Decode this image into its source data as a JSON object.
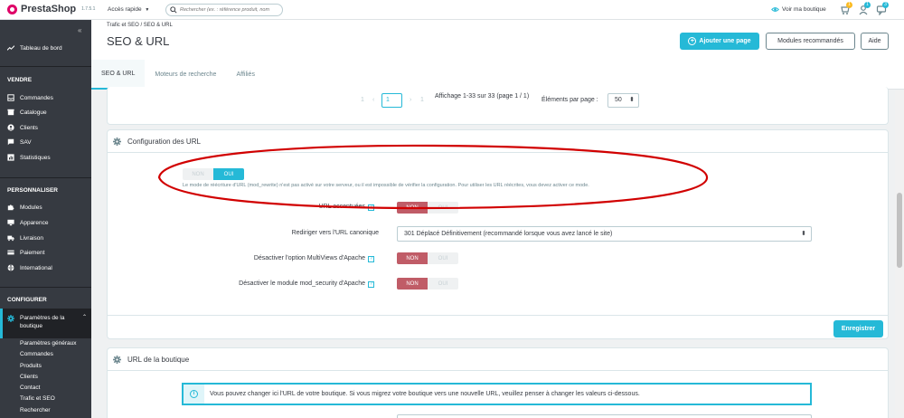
{
  "header": {
    "brand": "PrestaShop",
    "version": "1.7.5.1",
    "quick_access": "Accès rapide",
    "search_placeholder": "Rechercher (ex. : référence produit, nom",
    "view_shop": "Voir ma boutique",
    "notifications": [
      {
        "icon": "cart-icon",
        "count": "1",
        "color": "#fbbb22"
      },
      {
        "icon": "person-icon",
        "count": "1",
        "color": "#25b9d7"
      },
      {
        "icon": "chat-icon",
        "count": "3",
        "color": "#25b9d7"
      }
    ]
  },
  "sidebar": {
    "dashboard": "Tableau de bord",
    "sections": [
      {
        "title": "VENDRE",
        "items": [
          "Commandes",
          "Catalogue",
          "Clients",
          "SAV",
          "Statistiques"
        ]
      },
      {
        "title": "PERSONNALISER",
        "items": [
          "Modules",
          "Apparence",
          "Livraison",
          "Paiement",
          "International"
        ]
      },
      {
        "title": "CONFIGURER",
        "active": "Paramètres de la boutique",
        "subitems": [
          "Paramètres généraux",
          "Commandes",
          "Produits",
          "Clients",
          "Contact",
          "Trafic et SEO",
          "Rechercher"
        ]
      }
    ]
  },
  "page": {
    "breadcrumb": "Trafic et SEO  /  SEO & URL",
    "title": "SEO & URL",
    "add_button": "Ajouter une page",
    "modules_button": "Modules recommandés",
    "help_button": "Aide",
    "tabs": [
      "SEO & URL",
      "Moteurs de recherche",
      "Affiliés"
    ]
  },
  "pagination": {
    "first": "1",
    "prev": "‹",
    "current": "1",
    "next": "›",
    "last": "1",
    "display": "Affichage 1-33 sur 33 (page 1 / 1)",
    "per_page_label": "Éléments par page :",
    "per_page": "50"
  },
  "config_urls": {
    "title": "Configuration des URL",
    "friendly_switch": {
      "off": "NON",
      "on": "OUI",
      "value": "OUI"
    },
    "friendly_help": "Le mode de réécriture d'URL (mod_rewrite) n'est pas activé sur votre serveur, ou il est impossible de vérifier la configuration. Pour utiliser les URL réécrites, vous devez activer ce mode.",
    "accented_label": "URL accentuées",
    "accented_switch": {
      "off": "NON",
      "on": "OUI",
      "value": "NON"
    },
    "canonical_label": "Rediriger vers l'URL canonique",
    "canonical_value": "301 Déplacé Définitivement (recommandé lorsque vous avez lancé le site)",
    "multiviews_label": "Désactiver l'option MultiViews d'Apache",
    "multiviews_switch": {
      "off": "NON",
      "on": "OUI",
      "value": "NON"
    },
    "modsecurity_label": "Désactiver le module mod_security d'Apache",
    "modsecurity_switch": {
      "off": "NON",
      "on": "OUI",
      "value": "NON"
    },
    "save": "Enregistrer",
    "help_mark": "?"
  },
  "shop_url": {
    "title": "URL de la boutique",
    "info": "Vous pouvez changer ici l'URL de votre boutique. Si vous migrez votre boutique vers une nouvelle URL, veuillez penser à changer les valeurs ci-dessous."
  },
  "colors": {
    "accent": "#25b9d7",
    "danger_switch": "#c05c67",
    "sidebar": "#363a41",
    "annotation": "#d10000"
  }
}
